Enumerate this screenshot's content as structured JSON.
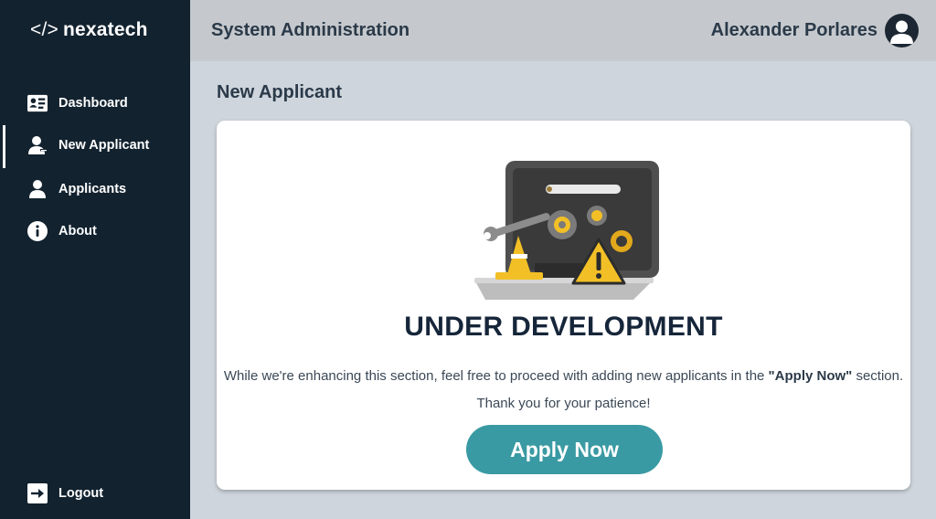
{
  "brand": {
    "code": "</>",
    "name": "nexatech"
  },
  "header": {
    "title": "System Administration",
    "user_name": "Alexander Porlares"
  },
  "sidebar": {
    "items": [
      {
        "label": "Dashboard",
        "icon": "dashboard-icon"
      },
      {
        "label": "New Applicant",
        "icon": "add-user-icon",
        "active": true
      },
      {
        "label": "Applicants",
        "icon": "user-icon"
      },
      {
        "label": "About",
        "icon": "info-icon"
      }
    ],
    "logout": {
      "label": "Logout",
      "icon": "logout-icon"
    }
  },
  "main": {
    "heading": "New Applicant",
    "card": {
      "title": "UNDER DEVELOPMENT",
      "message_before": "While we're enhancing this section, feel free to proceed with adding new applicants in the ",
      "message_bold": "\"Apply Now\"",
      "message_after": " section. Thank you for your patience!",
      "button_label": "Apply Now"
    }
  },
  "colors": {
    "sidebar": "#12222f",
    "topbar": "#c5c9cd",
    "background": "#ced5dc",
    "accent": "#3a9aa3"
  }
}
